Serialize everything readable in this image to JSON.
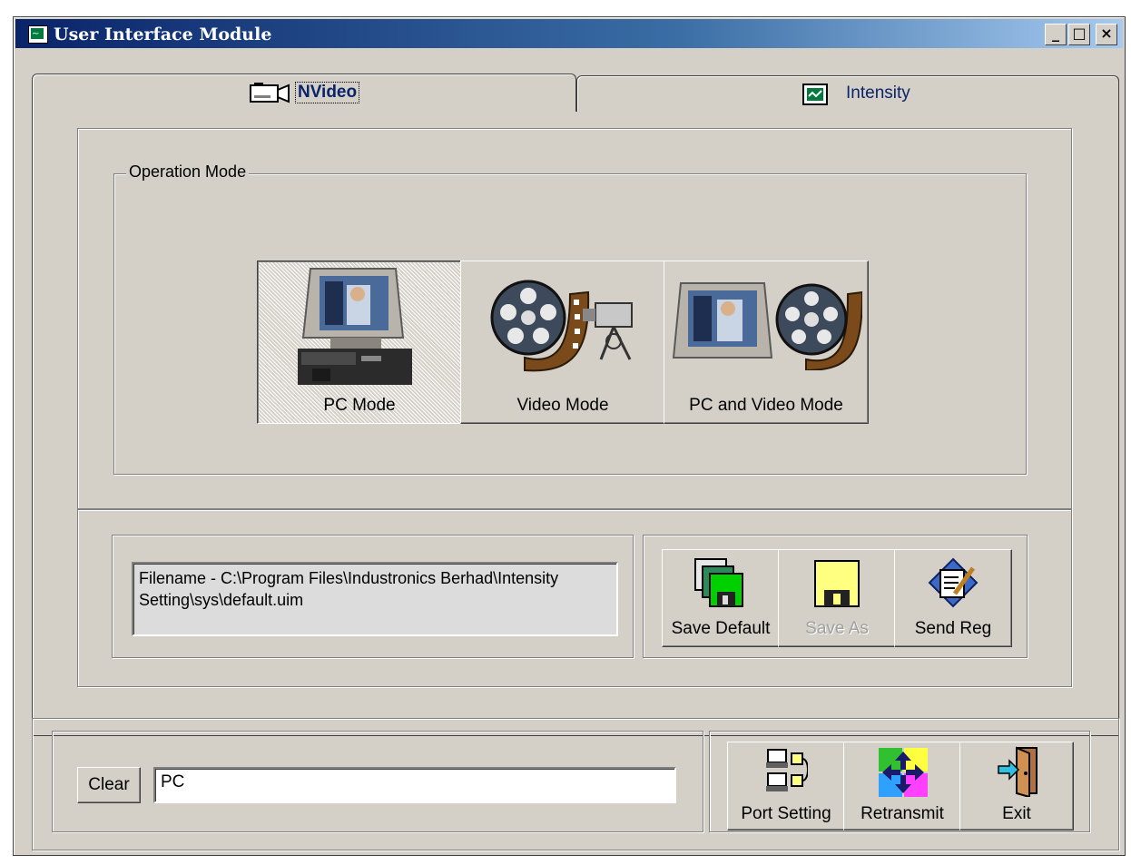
{
  "window": {
    "title": "User Interface Module",
    "controls": [
      "minimize",
      "maximize",
      "close"
    ]
  },
  "tabs": [
    {
      "label": "NVideo",
      "active": true,
      "icon": "video-camera-icon"
    },
    {
      "label": "Intensity",
      "active": false,
      "icon": "app-screen-icon"
    }
  ],
  "operation_mode": {
    "group_label": "Operation Mode",
    "buttons": [
      {
        "label": "PC Mode",
        "mnemonic": "C",
        "pressed": true,
        "icon": "computer-monitor-icon"
      },
      {
        "label": "Video Mode",
        "mnemonic": "V",
        "pressed": false,
        "icon": "film-reel-camera-icon"
      },
      {
        "label": "PC and Video Mode",
        "mnemonic": "M",
        "pressed": false,
        "icon": "monitor-film-reel-icon"
      }
    ]
  },
  "file": {
    "filename_text": " Filename - C:\\Program Files\\Industronics Berhad\\Intensity Setting\\sys\\default.uim"
  },
  "file_actions": [
    {
      "label": "Save Default",
      "enabled": true,
      "icon": "stacked-floppy-icon"
    },
    {
      "label": "Save As",
      "enabled": false,
      "icon": "floppy-disk-icon"
    },
    {
      "label": "Send Reg",
      "enabled": true,
      "icon": "document-pencil-icon"
    }
  ],
  "status": {
    "clear_label": "Clear",
    "clear_mnemonic": "e",
    "value": "PC"
  },
  "bottom_actions": [
    {
      "label": "Port Setting",
      "mnemonic": "P",
      "icon": "network-ports-icon"
    },
    {
      "label": "Retransmit",
      "mnemonic": "R",
      "icon": "retransmit-arrows-icon"
    },
    {
      "label": "Exit",
      "mnemonic": "x",
      "icon": "exit-door-icon"
    }
  ]
}
